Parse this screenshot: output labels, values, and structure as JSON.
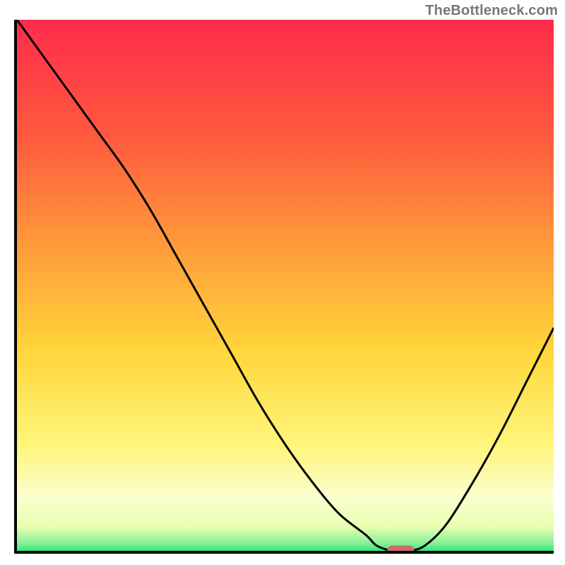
{
  "attribution": "TheBottleneck.com",
  "colors": {
    "top": "#ff2b4c",
    "mid_upper": "#ff8a3a",
    "mid": "#ffd53a",
    "mid_lower": "#fff57a",
    "pale_yellow": "#fbffcf",
    "green": "#2fe87a",
    "axis": "#000000",
    "curve": "#000000",
    "marker": "#cf6a6a",
    "attribution": "#777777"
  },
  "chart_data": {
    "type": "line",
    "title": "",
    "xlabel": "",
    "ylabel": "",
    "xlim": [
      0,
      100
    ],
    "ylim": [
      0,
      100
    ],
    "x": [
      0,
      5,
      10,
      15,
      20,
      25,
      30,
      35,
      40,
      45,
      50,
      55,
      60,
      65,
      67,
      70,
      73,
      76,
      80,
      85,
      90,
      95,
      100
    ],
    "values": [
      100,
      93,
      86,
      79,
      72,
      64,
      55,
      46,
      37,
      28,
      20,
      13,
      7,
      3,
      1,
      0,
      0,
      1,
      5,
      13,
      22,
      32,
      42
    ],
    "series": [
      {
        "name": "bottleneck-curve",
        "x": [
          0,
          5,
          10,
          15,
          20,
          25,
          30,
          35,
          40,
          45,
          50,
          55,
          60,
          65,
          67,
          70,
          73,
          76,
          80,
          85,
          90,
          95,
          100
        ],
        "y": [
          100,
          93,
          86,
          79,
          72,
          64,
          55,
          46,
          37,
          28,
          20,
          13,
          7,
          3,
          1,
          0,
          0,
          1,
          5,
          13,
          22,
          32,
          42
        ]
      }
    ],
    "marker": {
      "x_range": [
        69,
        74
      ],
      "y": 0
    },
    "gradient_stops": [
      {
        "offset": 0.0,
        "color": "#ff2b4c"
      },
      {
        "offset": 0.22,
        "color": "#ff5a3e"
      },
      {
        "offset": 0.45,
        "color": "#ffa23a"
      },
      {
        "offset": 0.62,
        "color": "#ffd53a"
      },
      {
        "offset": 0.8,
        "color": "#fff57a"
      },
      {
        "offset": 0.9,
        "color": "#fbffcf"
      },
      {
        "offset": 0.955,
        "color": "#e8ffb0"
      },
      {
        "offset": 0.985,
        "color": "#8af09a"
      },
      {
        "offset": 1.0,
        "color": "#2fe87a"
      }
    ]
  }
}
